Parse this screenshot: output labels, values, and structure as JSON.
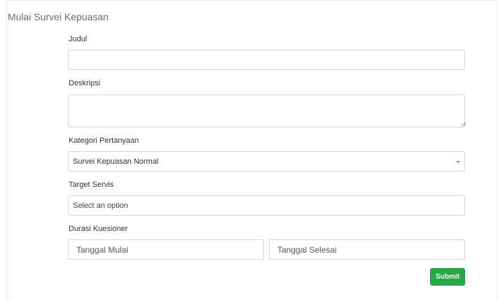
{
  "card": {
    "title": "Mulai Survei Kepuasan"
  },
  "form": {
    "judul": {
      "label": "Judul",
      "value": ""
    },
    "deskripsi": {
      "label": "Deskripsi",
      "value": ""
    },
    "kategori": {
      "label": "Kategori Pertanyaan",
      "selected": "Survei Kepuasan Normal",
      "icon": "chevron-down-icon"
    },
    "target": {
      "label": "Target Servis",
      "placeholder": "Select an option"
    },
    "durasi": {
      "label": "Durasi Kuesioner",
      "start_placeholder": "Tanggal Mulai",
      "end_placeholder": "Tanggal Selesai"
    },
    "submit_label": "Submit"
  },
  "colors": {
    "submit_bg": "#28a745",
    "border": "#d4d4d4",
    "title": "#6b6b6b"
  }
}
